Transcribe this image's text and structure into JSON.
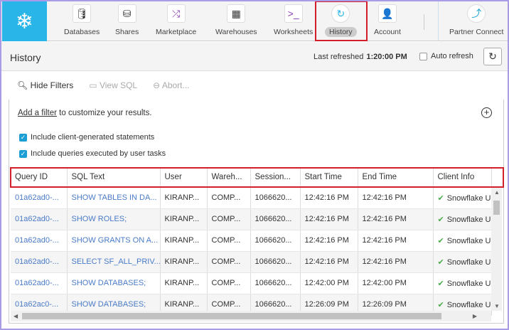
{
  "nav": {
    "items": [
      {
        "label": "Databases",
        "icon": "database-icon"
      },
      {
        "label": "Shares",
        "icon": "shares-icon"
      },
      {
        "label": "Marketplace",
        "icon": "shuffle-icon"
      },
      {
        "label": "Warehouses",
        "icon": "warehouse-icon"
      },
      {
        "label": "Worksheets",
        "icon": "terminal-icon"
      },
      {
        "label": "History",
        "icon": "history-icon",
        "active": true
      },
      {
        "label": "Account",
        "icon": "user-icon"
      },
      {
        "label": "Partner Connect",
        "icon": "partner-connect-icon"
      }
    ]
  },
  "header": {
    "title": "History",
    "last_refreshed_label": "Last refreshed",
    "last_refreshed_time": "1:20:00 PM",
    "auto_refresh": "Auto refresh"
  },
  "toolbar": {
    "hide_filters": "Hide Filters",
    "view_sql": "View SQL",
    "abort": "Abort..."
  },
  "filters": {
    "add_filter": "Add a filter",
    "add_filter_suffix": " to customize your results.",
    "opt1": "Include client-generated statements",
    "opt2": "Include queries executed by user tasks"
  },
  "table": {
    "columns": [
      "Query ID",
      "SQL Text",
      "User",
      "Wareh...",
      "Session...",
      "Start Time",
      "End Time",
      "Client Info"
    ],
    "rows": [
      [
        "01a62ad0-...",
        "SHOW TABLES IN DA...",
        "KIRANP...",
        "COMP...",
        "1066620...",
        "12:42:16 PM",
        "12:42:16 PM",
        "Snowflake U"
      ],
      [
        "01a62ad0-...",
        "SHOW ROLES;",
        "KIRANP...",
        "COMP...",
        "1066620...",
        "12:42:16 PM",
        "12:42:16 PM",
        "Snowflake U"
      ],
      [
        "01a62ad0-...",
        "SHOW GRANTS ON A...",
        "KIRANP...",
        "COMP...",
        "1066620...",
        "12:42:16 PM",
        "12:42:16 PM",
        "Snowflake U"
      ],
      [
        "01a62ad0-...",
        "SELECT SF_ALL_PRIV...",
        "KIRANP...",
        "COMP...",
        "1066620...",
        "12:42:16 PM",
        "12:42:16 PM",
        "Snowflake U"
      ],
      [
        "01a62ad0-...",
        "SHOW DATABASES;",
        "KIRANP...",
        "COMP...",
        "1066620...",
        "12:42:00 PM",
        "12:42:00 PM",
        "Snowflake U"
      ],
      [
        "01a62ac0-...",
        "SHOW DATABASES;",
        "KIRANP...",
        "COMP...",
        "1066620...",
        "12:26:09 PM",
        "12:26:09 PM",
        "Snowflake U"
      ]
    ]
  },
  "colors": {
    "brand": "#29b5e8",
    "highlight": "#d21f2a",
    "link": "#4a7bc8",
    "checkbox": "#1a9ed4"
  }
}
